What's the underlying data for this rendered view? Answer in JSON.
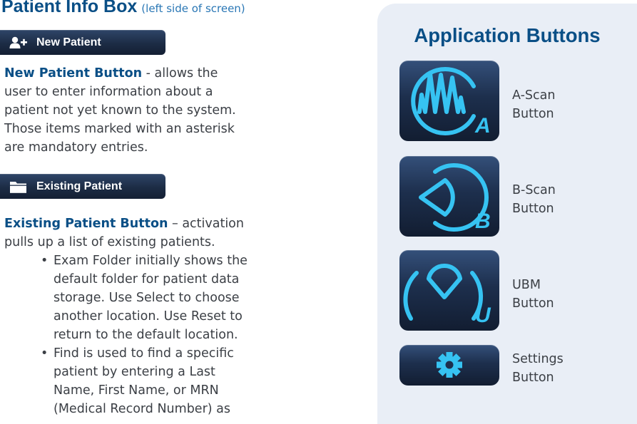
{
  "left": {
    "section_title": "Patient Info Box",
    "section_subtitle": "(left side of screen)",
    "new_patient_button": {
      "label": "New Patient",
      "icon": "add-person-icon"
    },
    "new_patient_para": {
      "term": "New Patient Button",
      "text": " - allows the user to enter information about a patient not yet known to the system. Those items marked with an asterisk are mandatory entries."
    },
    "existing_patient_button": {
      "label": "Existing Patient",
      "icon": "folder-icon"
    },
    "existing_patient_para": {
      "term": "Existing Patient Button",
      "text": " – activation pulls up a list of existing patients."
    },
    "bullets": [
      "Exam Folder initially shows the default folder for patient data storage. Use Select to choose another location. Use Reset to return to the default location.",
      "Find is used to find a specific patient by entering a Last Name, First Name, or MRN (Medical Record Number) as"
    ]
  },
  "panel": {
    "title": "Application Buttons",
    "buttons": [
      {
        "line1": "A-Scan",
        "line2": "Button",
        "letter": "A",
        "icon": "ascan-icon"
      },
      {
        "line1": "B-Scan",
        "line2": "Button",
        "letter": "B",
        "icon": "bscan-icon"
      },
      {
        "line1": "UBM",
        "line2": "Button",
        "letter": "U",
        "icon": "ubm-icon"
      },
      {
        "line1": "Settings",
        "line2": "Button",
        "icon": "gear-icon"
      }
    ]
  },
  "colors": {
    "heading_blue": "#0a4f86",
    "accent_cyan": "#36c3f2",
    "panel_bg": "#e9eef6",
    "button_navy": "#1c2c45",
    "body_text": "#3b3f45"
  }
}
